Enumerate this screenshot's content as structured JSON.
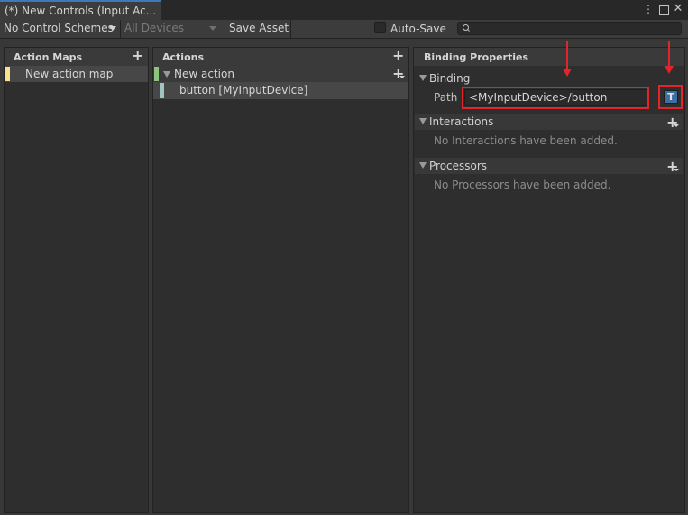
{
  "window": {
    "tab_title": "(*) New Controls (Input Ac...",
    "menu_icon": "kebab-menu-icon",
    "maximize_icon": "maximize-icon",
    "close_icon": "close-icon"
  },
  "toolbar": {
    "control_schemes": "No Control Schemes",
    "devices": "All Devices",
    "save_asset": "Save Asset",
    "auto_save": "Auto-Save",
    "auto_save_checked": false,
    "search_value": "",
    "search_icon": "search-icon"
  },
  "action_maps": {
    "title": "Action Maps",
    "items": [
      {
        "label": "New action map",
        "color": "#f6e28f"
      }
    ]
  },
  "actions": {
    "title": "Actions",
    "action": {
      "label": "New action",
      "color": "#8cc27d"
    },
    "binding": {
      "label": "button [MyInputDevice]",
      "color": "#9fc4c2"
    }
  },
  "binding_properties": {
    "title": "Binding Properties",
    "binding_section": "Binding",
    "path_label": "Path",
    "path_value": "<MyInputDevice>/button",
    "t_button": "T",
    "interactions_section": "Interactions",
    "interactions_empty": "No Interactions have been added.",
    "processors_section": "Processors",
    "processors_empty": "No Processors have been added."
  },
  "colors": {
    "annotation": "#e3242b",
    "tab_accent": "#3a79bb",
    "t_button_bg": "#3d6fa3"
  }
}
